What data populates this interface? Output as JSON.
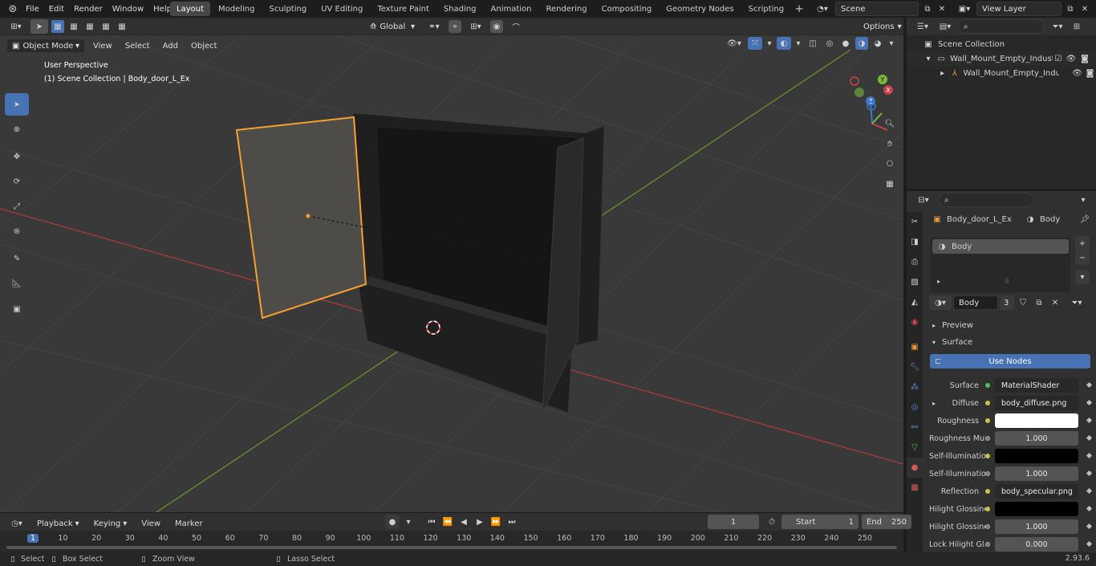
{
  "menu": {
    "items": [
      "File",
      "Edit",
      "Render",
      "Window",
      "Help"
    ]
  },
  "workspaces": [
    "Layout",
    "Modeling",
    "Sculpting",
    "UV Editing",
    "Texture Paint",
    "Shading",
    "Animation",
    "Rendering",
    "Compositing",
    "Geometry Nodes",
    "Scripting"
  ],
  "active_workspace": "Layout",
  "scene": {
    "name": "Scene",
    "view_layer": "View Layer"
  },
  "viewport": {
    "mode": "Object Mode",
    "menus": [
      "View",
      "Select",
      "Add",
      "Object"
    ],
    "transform_orientation": "Global",
    "options_label": "Options",
    "overlay_title": "User Perspective",
    "overlay_sub": "(1) Scene Collection | Body_door_L_Ex"
  },
  "outliner": {
    "root": "Scene Collection",
    "items": [
      "Wall_Mount_Empty_Industrial",
      "Wall_Mount_Empty_Indus"
    ]
  },
  "properties": {
    "object": "Body_door_L_Ex",
    "material_tab": "Body",
    "slot": "Body",
    "material_name": "Body",
    "users": "3",
    "preview": "Preview",
    "surface_section": "Surface",
    "use_nodes": "Use Nodes",
    "rows": [
      {
        "label": "Surface",
        "value": "MaterialShader",
        "dot": "green"
      },
      {
        "label": "Diffuse",
        "value": "body_diffuse.png",
        "dot": "yellow"
      },
      {
        "label": "Roughness",
        "value": "",
        "dot": "yellow",
        "swatch": "#ffffff"
      },
      {
        "label": "Roughness Mult...",
        "value": "1.000",
        "dot": "gray"
      },
      {
        "label": "Self-Illumination",
        "value": "",
        "dot": "yellow",
        "swatch": "#000000"
      },
      {
        "label": "Self-Illumination...",
        "value": "1.000",
        "dot": "gray"
      },
      {
        "label": "Reflection",
        "value": "body_specular.png",
        "dot": "yellow"
      },
      {
        "label": "Hilight Glossiness",
        "value": "",
        "dot": "yellow",
        "swatch": "#000000"
      },
      {
        "label": "Hilight Glossiness...",
        "value": "1.000",
        "dot": "gray"
      },
      {
        "label": "Lock Hilight Gl...",
        "value": "0.000",
        "dot": "gray"
      }
    ]
  },
  "timeline": {
    "menus": [
      "Playback",
      "Keying",
      "View",
      "Marker"
    ],
    "current_frame": "1",
    "start_label": "Start",
    "start": "1",
    "end_label": "End",
    "end": "250",
    "ticks": [
      "1",
      "10",
      "20",
      "30",
      "40",
      "50",
      "60",
      "70",
      "80",
      "90",
      "100",
      "110",
      "120",
      "130",
      "140",
      "150",
      "160",
      "170",
      "180",
      "190",
      "200",
      "210",
      "220",
      "230",
      "240",
      "250"
    ]
  },
  "status": {
    "select": "Select",
    "box_select": "Box Select",
    "zoom": "Zoom View",
    "lasso": "Lasso Select",
    "version": "2.93.6"
  }
}
